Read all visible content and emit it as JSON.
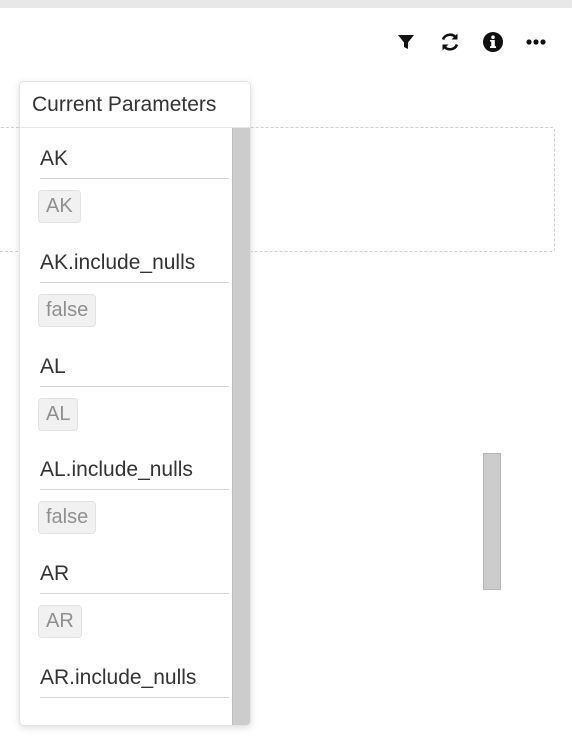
{
  "toolbar": {
    "icons": [
      "filter-icon",
      "refresh-icon",
      "info-icon",
      "more-icon"
    ]
  },
  "popover": {
    "title": "Current Parameters",
    "params": [
      {
        "key": "AK",
        "value": "AK"
      },
      {
        "key": "AK.include_nulls",
        "value": "false"
      },
      {
        "key": "AL",
        "value": "AL"
      },
      {
        "key": "AL.include_nulls",
        "value": "false"
      },
      {
        "key": "AR",
        "value": "AR"
      },
      {
        "key": "AR.include_nulls",
        "value": ""
      }
    ]
  }
}
